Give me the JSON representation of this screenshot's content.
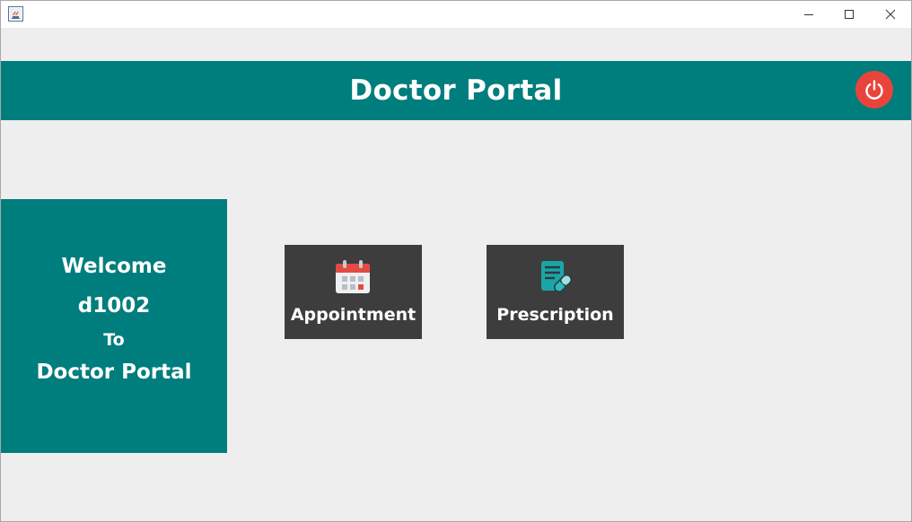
{
  "window": {
    "title": "",
    "controls": [
      "minimize-icon",
      "maximize-icon",
      "close-icon"
    ]
  },
  "header": {
    "title": "Doctor Portal",
    "background": "#007d7d",
    "logout_icon": "power-icon",
    "logout_color": "#e9443b"
  },
  "welcome": {
    "line1": "Welcome",
    "username": "d1002",
    "line3": "To",
    "line4": "Doctor Portal"
  },
  "tiles": [
    {
      "label": "Appointment",
      "icon": "calendar-icon"
    },
    {
      "label": "Prescription",
      "icon": "prescription-icon"
    }
  ],
  "colors": {
    "teal": "#007d7d",
    "tile_bg": "#3d3d3d",
    "page_bg": "#eeeeee"
  }
}
